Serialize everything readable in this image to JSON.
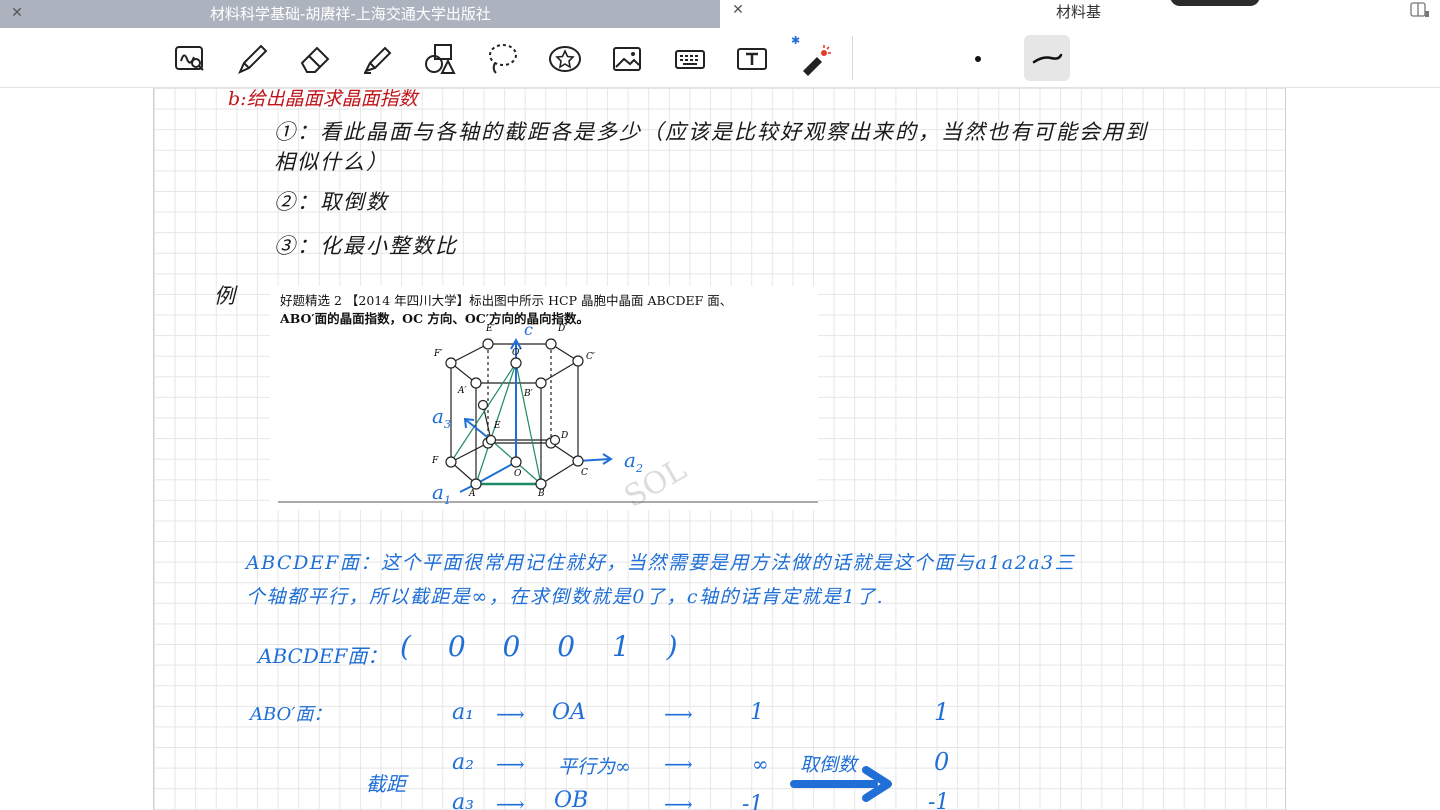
{
  "tabs": [
    {
      "title": "材料科学基础-胡赓祥-上海交通大学出版社",
      "active": true
    },
    {
      "title": "材料基",
      "active": false
    }
  ],
  "toolbar": {
    "tools": [
      "zoom-handwriting",
      "pen",
      "eraser",
      "highlighter",
      "shapes",
      "lasso",
      "sticker",
      "image",
      "keyboard",
      "text",
      "laser-pointer"
    ],
    "bluetooth_glyph": "✱"
  },
  "notes": {
    "heading": "b:给出晶面求晶面指数",
    "step1_line1": "①：看此晶面与各轴的截距各是多少（应该是比较好观察出来的，当然也有可能会用到",
    "step1_line2": "相似什么）",
    "step2": "②：取倒数",
    "step3": "③：化最小整数比",
    "example_label": "例"
  },
  "problem": {
    "line1": "好题精选 2 【2014 年四川大学】标出图中所示 HCP 晶胞中晶面 ABCDEF 面、",
    "line2": "ABO′面的晶面指数，OC 方向、OC′方向的晶向指数。",
    "labels": {
      "E_top": "E′",
      "D_top": "D′",
      "F_top": "F′",
      "C_top": "C′",
      "O_top": "O′",
      "A_mid": "A′",
      "B_mid": "B′",
      "E": "E",
      "D": "D",
      "F": "F",
      "C": "C",
      "O": "O",
      "A": "A",
      "B": "B"
    },
    "axis_labels": {
      "c": "c",
      "a1": "a",
      "a1_sub": "1",
      "a2": "a",
      "a2_sub": "2",
      "a3": "a",
      "a3_sub": "3"
    }
  },
  "annotations": {
    "abcdef_expl_line1": "ABCDEF面：这个平面很常用记住就好，当然需要是用方法做的话就是这个面与a1a2a3三",
    "abcdef_expl_line2": "个轴都平行，所以截距是∞，在求倒数就是0了，c轴的话肯定就是1了.",
    "abcdef_result_label": "ABCDEF面：",
    "abcdef_result_index": "( 0  0  0  1 )",
    "abo_label": "ABO′面：",
    "jieju_label": "截距",
    "take_reciprocal": "取倒数",
    "rows": [
      {
        "axis": "a₁",
        "intercept": "OA",
        "value": "1",
        "reciprocal": "1"
      },
      {
        "axis": "a₂",
        "intercept": "平行为∞",
        "value": "∞",
        "reciprocal": "0"
      },
      {
        "axis": "a₃",
        "intercept": "OB",
        "value": "-1",
        "reciprocal": "-1"
      }
    ],
    "arrow_glyph": "⟶"
  },
  "colors": {
    "tab_active": "#adb3be",
    "ink_black": "#1a1a1a",
    "ink_red": "#c0141a",
    "ink_blue": "#1f6fd6",
    "grid": "#e6e6e6"
  }
}
